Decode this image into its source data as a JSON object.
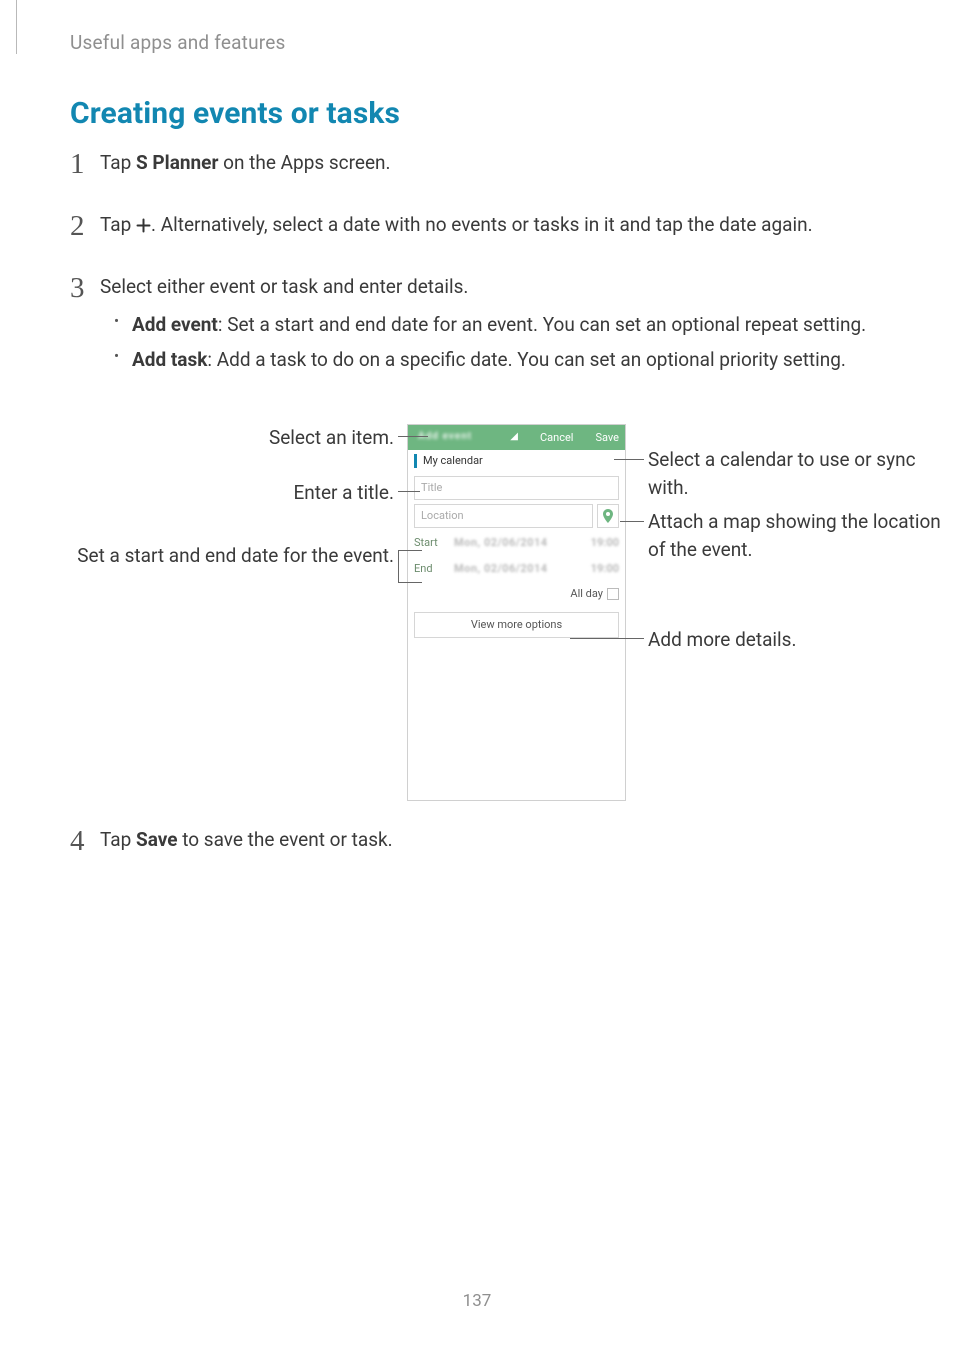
{
  "chapter": "Useful apps and features",
  "section_title": "Creating events or tasks",
  "steps": {
    "s1": {
      "num": "1",
      "pre": "Tap ",
      "b": "S Planner",
      "post": " on the Apps screen."
    },
    "s2": {
      "num": "2",
      "pre": "Tap ",
      "post": ". Alternatively, select a date with no events or tasks in it and tap the date again."
    },
    "s3": {
      "num": "3",
      "text": "Select either event or task and enter details.",
      "bullets": [
        {
          "b": "Add event",
          "rest": ": Set a start and end date for an event. You can set an optional repeat setting."
        },
        {
          "b": "Add task",
          "rest": ": Add a task to do on a specific date. You can set an optional priority setting."
        }
      ]
    },
    "s4": {
      "num": "4",
      "pre": "Tap ",
      "b": "Save",
      "post": " to save the event or task."
    }
  },
  "callouts": {
    "left": {
      "select_item": "Select an item.",
      "enter_title": "Enter a title.",
      "set_dates": "Set a start and end date for the event."
    },
    "right": {
      "select_cal": "Select a calendar to use or sync with.",
      "attach_map": "Attach a map showing the location of the event.",
      "add_details": "Add more details."
    }
  },
  "phone": {
    "tab_hint": "Add event",
    "cancel": "Cancel",
    "save": "Save",
    "my_calendar": "My calendar",
    "title_ph": "Title",
    "location_ph": "Location",
    "start_label": "Start",
    "end_label": "End",
    "date_blur": "Mon, 02/06/2014",
    "time_blur": "19:00",
    "all_day": "All day",
    "view_more": "View more options"
  },
  "icons": {
    "plus": "plus-icon",
    "pin": "map-pin-icon",
    "signal": "signal-icon"
  },
  "page_number": "137"
}
